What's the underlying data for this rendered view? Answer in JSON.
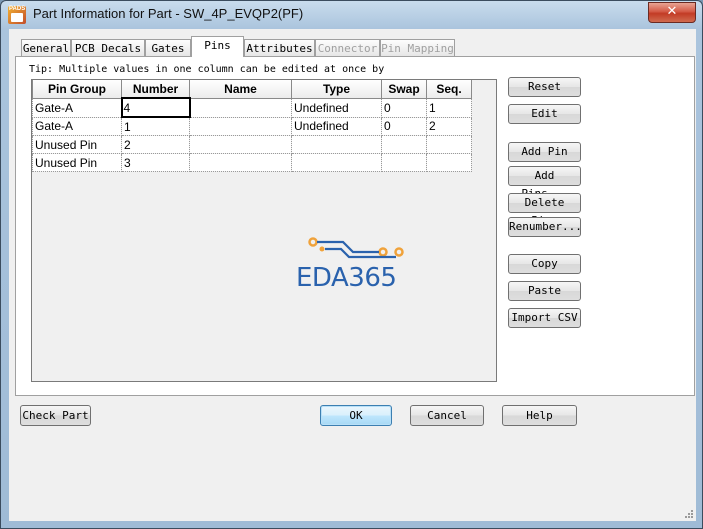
{
  "window": {
    "title": "Part Information for Part - SW_4P_EVQP2(PF)",
    "icon_label": "PADS"
  },
  "tabs": [
    {
      "label": "General",
      "state": "normal"
    },
    {
      "label": "PCB Decals",
      "state": "normal"
    },
    {
      "label": "Gates",
      "state": "normal"
    },
    {
      "label": "Pins",
      "state": "active"
    },
    {
      "label": "Attributes",
      "state": "normal"
    },
    {
      "label": "Connector",
      "state": "disabled"
    },
    {
      "label": "Pin Mapping",
      "state": "disabled"
    }
  ],
  "tip": "Tip: Multiple values in one column can be edited at once by",
  "grid": {
    "columns": [
      "Pin Group",
      "Number",
      "Name",
      "Type",
      "Swap",
      "Seq."
    ],
    "rows": [
      [
        "Gate-A",
        "4",
        "",
        "Undefined",
        "0",
        "1"
      ],
      [
        "Gate-A",
        "1",
        "",
        "Undefined",
        "0",
        "2"
      ],
      [
        "Unused Pin",
        "2",
        "",
        "",
        "",
        ""
      ],
      [
        "Unused Pin",
        "3",
        "",
        "",
        "",
        ""
      ]
    ],
    "selected_cell": [
      0,
      1
    ]
  },
  "side_buttons": {
    "reset": "Reset",
    "edit": "Edit",
    "add_pin": "Add Pin",
    "add_pins": "Add Pins...",
    "delete_pins": "Delete Pins",
    "renumber": "Renumber...",
    "copy": "Copy",
    "paste": "Paste",
    "import_csv": "Import CSV"
  },
  "bottom_buttons": {
    "check_part": "Check Part",
    "ok": "OK",
    "cancel": "Cancel",
    "help": "Help"
  },
  "watermark": {
    "text": "EDA365"
  },
  "colors": {
    "accent": "#2a62ad",
    "logo_orange": "#f0a23a",
    "close": "#c23b25"
  },
  "close_glyph": "✕"
}
